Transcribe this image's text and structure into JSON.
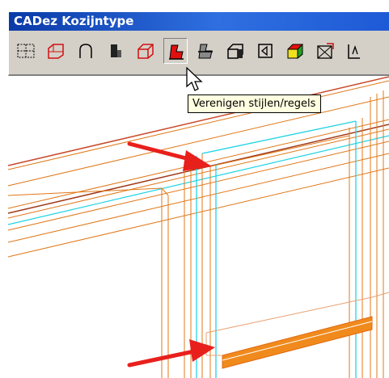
{
  "window": {
    "title": "CADez Kozijntype"
  },
  "toolbar": {
    "buttons": [
      {
        "icon": "dashed-grid-icon"
      },
      {
        "icon": "red-outline-frame-icon"
      },
      {
        "icon": "arch-icon"
      },
      {
        "icon": "profile-block-icon"
      },
      {
        "icon": "red-box-icon"
      },
      {
        "icon": "merge-styles-rules-icon",
        "pressed": true
      },
      {
        "icon": "merge-profile-icon"
      },
      {
        "icon": "box-panel-icon"
      },
      {
        "icon": "square-diamond-icon"
      },
      {
        "icon": "yellow-red-box-icon"
      },
      {
        "icon": "red-star-frame-icon"
      },
      {
        "icon": "partial-frame-icon"
      }
    ]
  },
  "tooltip": {
    "text": "Verenigen stijlen/regels"
  },
  "colors": {
    "arrow": "#e8201c",
    "frame": "#e07818",
    "cyan": "#20d4e4",
    "sill": "#f08a1c"
  }
}
